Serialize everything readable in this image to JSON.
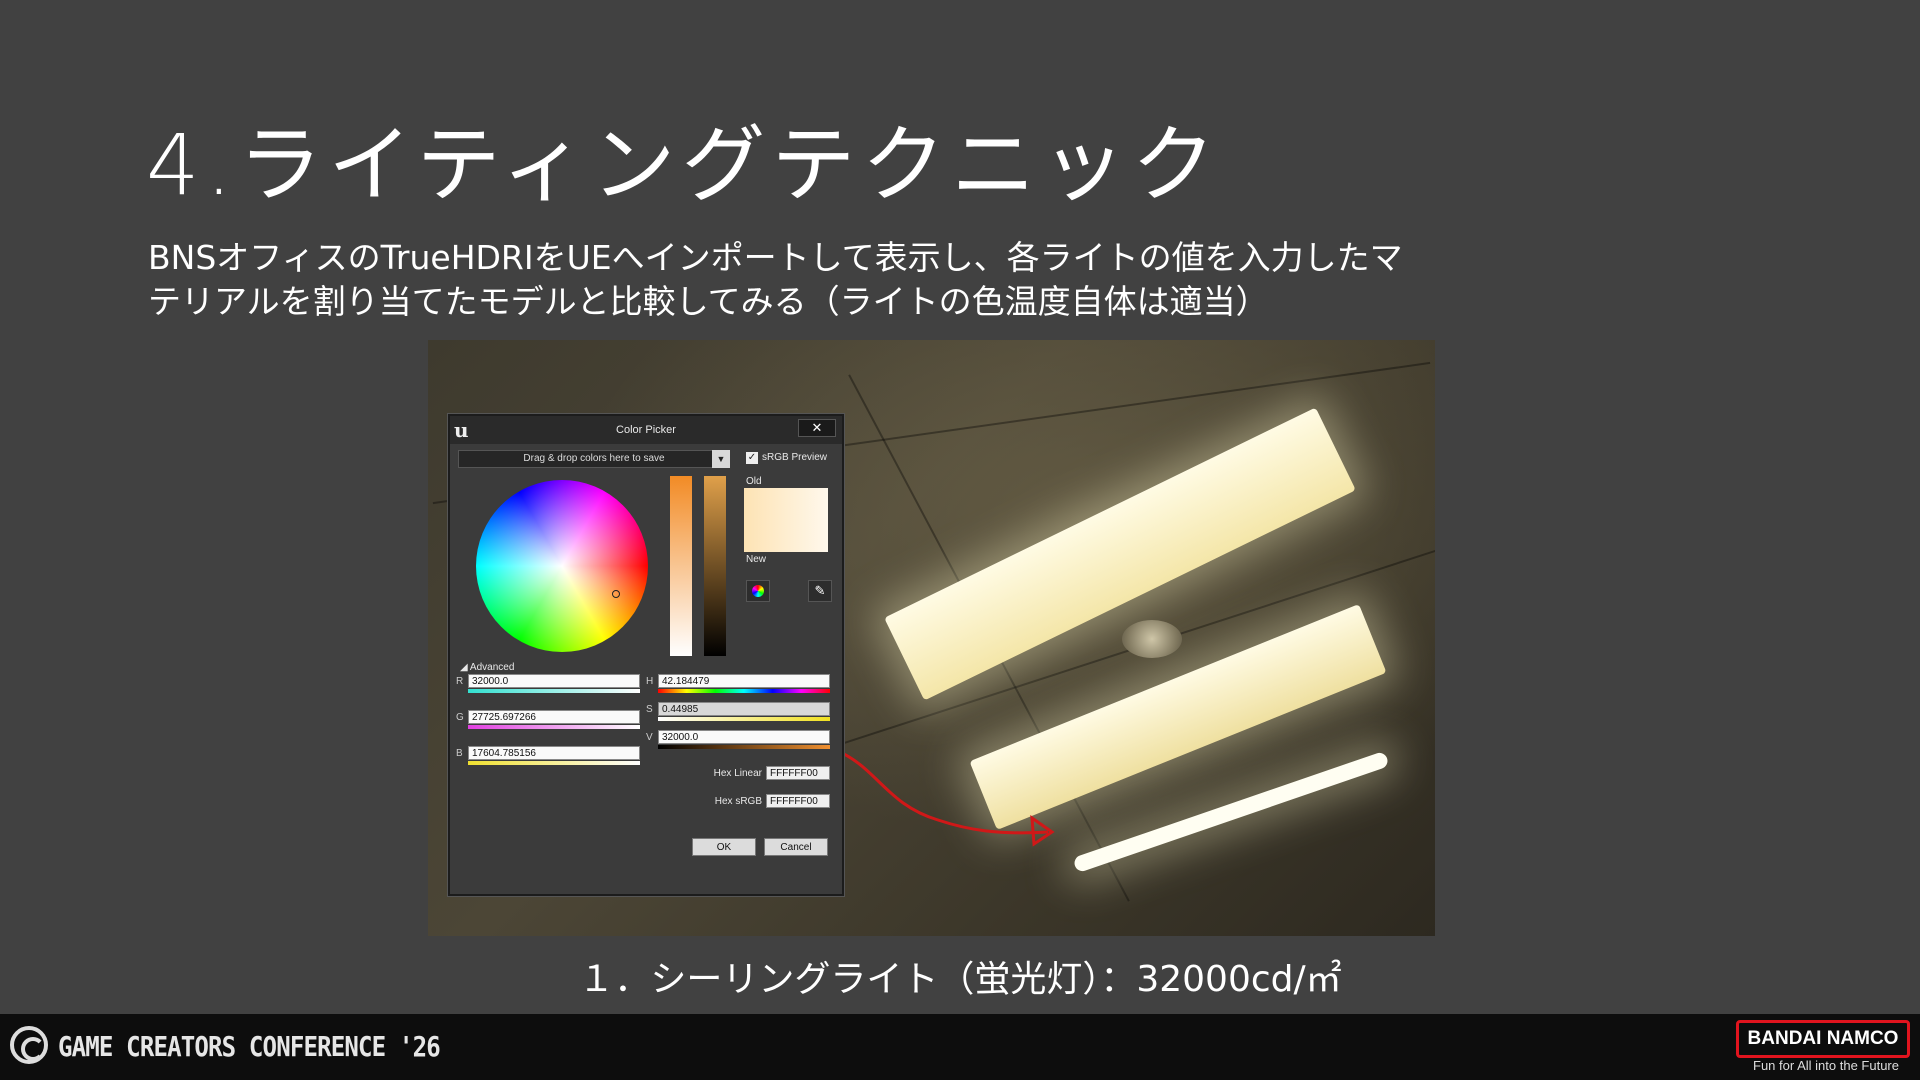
{
  "slide": {
    "title": "4.ライティングテクニック",
    "body_line1": "BNSオフィスのTrueHDRIをUEへインポートして表示し、各ライトの値を入力したマ",
    "body_line2": "テリアルを割り当てたモデルと比較してみる（ライトの色温度自体は適当）",
    "caption": "１．シーリングライト（蛍光灯）：32000cd/㎡"
  },
  "color_picker": {
    "title": "Color Picker",
    "close_label": "✕",
    "logo": "u",
    "swatch_placeholder": "Drag & drop colors here to save",
    "srgb_preview_label": "sRGB Preview",
    "srgb_checked": "✓",
    "old_label": "Old",
    "new_label": "New",
    "advanced_label": "◢ Advanced",
    "r_label": "R",
    "r_value": "32000.0",
    "g_label": "G",
    "g_value": "27725.697266",
    "b_label": "B",
    "b_value": "17604.785156",
    "h_label": "H",
    "h_value": "42.184479",
    "s_label": "S",
    "s_value": "0.44985",
    "v_label": "V",
    "v_value": "32000.0",
    "hex_linear_label": "Hex Linear",
    "hex_linear_value": "FFFFFF00",
    "hex_srgb_label": "Hex sRGB",
    "hex_srgb_value": "FFFFFF00",
    "ok_label": "OK",
    "cancel_label": "Cancel",
    "dropper_icon": "✎"
  },
  "footer": {
    "conference": "GAME CREATORS CONFERENCE '26",
    "brand": "BANDAI NAMCO",
    "tagline": "Fun for All into the Future"
  },
  "colors": {
    "background": "#414141",
    "footer_bg": "#0d0d0d",
    "brand_red": "#e1141e",
    "annotation_arrow": "#d01818"
  }
}
